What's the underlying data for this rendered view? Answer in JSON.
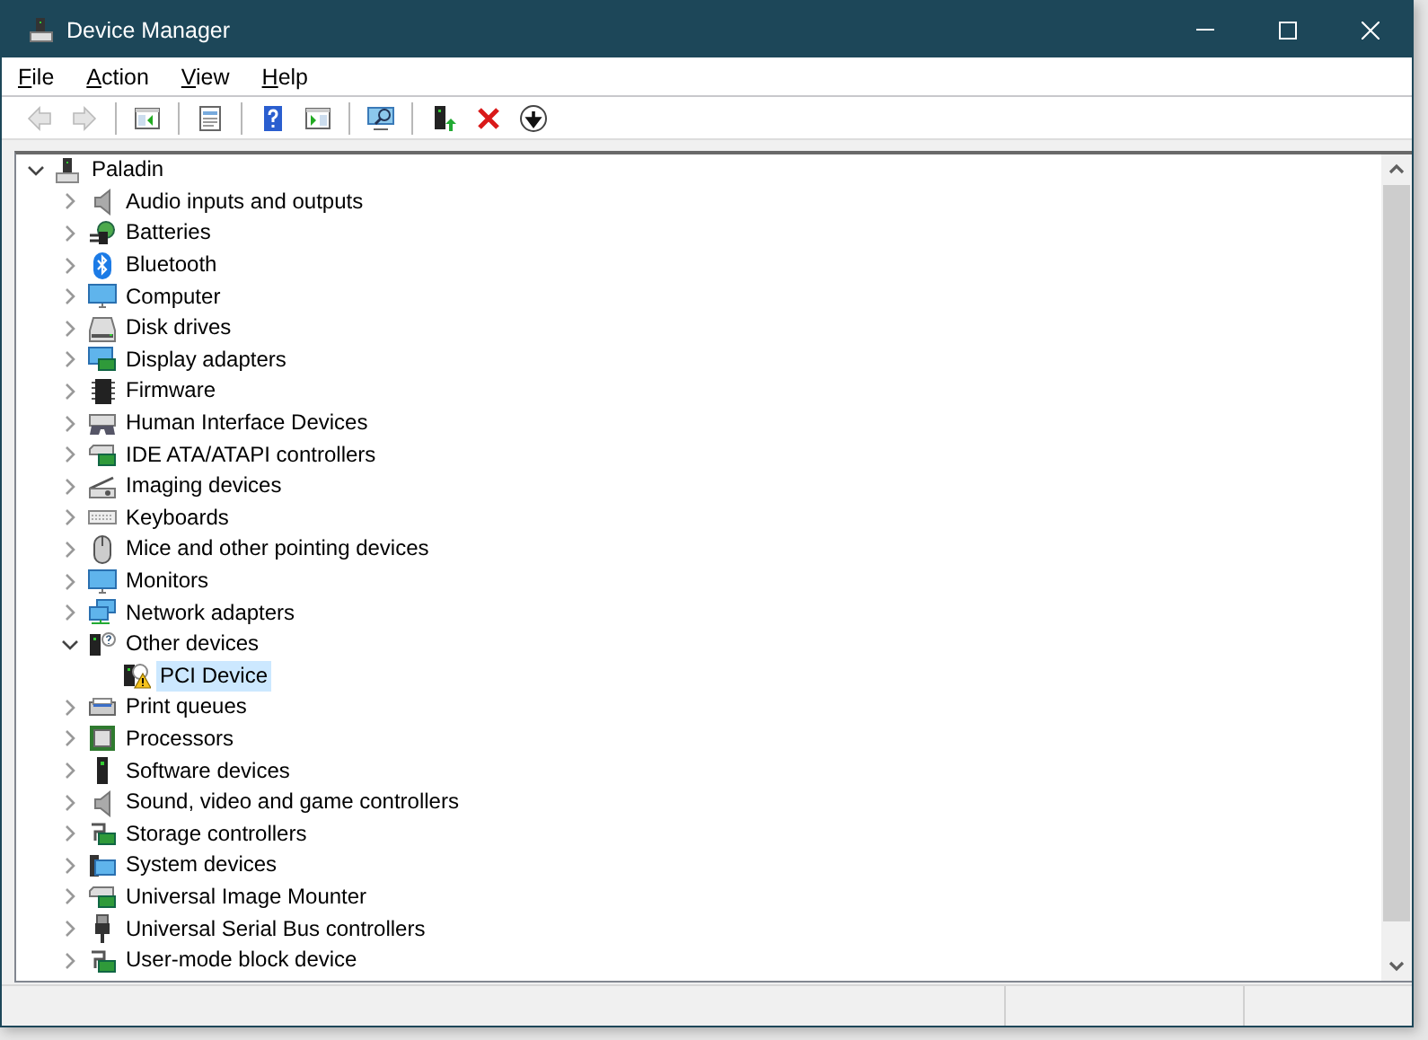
{
  "window": {
    "title": "Device Manager"
  },
  "menu": [
    {
      "label": "File"
    },
    {
      "label": "Action"
    },
    {
      "label": "View"
    },
    {
      "label": "Help"
    }
  ],
  "toolbar": [
    {
      "kind": "back",
      "disabled": true
    },
    {
      "kind": "forward",
      "disabled": true
    },
    {
      "kind": "sep"
    },
    {
      "kind": "show-hide-tree",
      "disabled": false
    },
    {
      "kind": "sep"
    },
    {
      "kind": "properties",
      "disabled": false
    },
    {
      "kind": "sep"
    },
    {
      "kind": "help",
      "disabled": false
    },
    {
      "kind": "show-hide-action",
      "disabled": false
    },
    {
      "kind": "sep"
    },
    {
      "kind": "scan",
      "disabled": false
    },
    {
      "kind": "sep"
    },
    {
      "kind": "update-driver",
      "disabled": false
    },
    {
      "kind": "uninstall",
      "disabled": false
    },
    {
      "kind": "disable",
      "disabled": false
    }
  ],
  "tree": [
    {
      "label": "Paladin",
      "kind": "computer-root",
      "expanded": true,
      "selected": false,
      "children": [
        {
          "label": "Audio inputs and outputs",
          "kind": "speaker",
          "expanded": false,
          "selected": false
        },
        {
          "label": "Batteries",
          "kind": "battery",
          "expanded": false,
          "selected": false
        },
        {
          "label": "Bluetooth",
          "kind": "bluetooth",
          "expanded": false,
          "selected": false
        },
        {
          "label": "Computer",
          "kind": "monitor",
          "expanded": false,
          "selected": false
        },
        {
          "label": "Disk drives",
          "kind": "disk",
          "expanded": false,
          "selected": false
        },
        {
          "label": "Display adapters",
          "kind": "display-card",
          "expanded": false,
          "selected": false
        },
        {
          "label": "Firmware",
          "kind": "chip",
          "expanded": false,
          "selected": false
        },
        {
          "label": "Human Interface Devices",
          "kind": "hid",
          "expanded": false,
          "selected": false
        },
        {
          "label": "IDE ATA/ATAPI controllers",
          "kind": "controller",
          "expanded": false,
          "selected": false
        },
        {
          "label": "Imaging devices",
          "kind": "camera",
          "expanded": false,
          "selected": false
        },
        {
          "label": "Keyboards",
          "kind": "keyboard",
          "expanded": false,
          "selected": false
        },
        {
          "label": "Mice and other pointing devices",
          "kind": "mouse",
          "expanded": false,
          "selected": false
        },
        {
          "label": "Monitors",
          "kind": "monitor",
          "expanded": false,
          "selected": false
        },
        {
          "label": "Network adapters",
          "kind": "network",
          "expanded": false,
          "selected": false
        },
        {
          "label": "Other devices",
          "kind": "unknown",
          "expanded": true,
          "selected": false,
          "children": [
            {
              "label": "PCI Device",
              "kind": "warning-device",
              "selected": true
            }
          ]
        },
        {
          "label": "Print queues",
          "kind": "printer",
          "expanded": false,
          "selected": false
        },
        {
          "label": "Processors",
          "kind": "processor",
          "expanded": false,
          "selected": false
        },
        {
          "label": "Software devices",
          "kind": "tower",
          "expanded": false,
          "selected": false
        },
        {
          "label": "Sound, video and game controllers",
          "kind": "speaker",
          "expanded": false,
          "selected": false
        },
        {
          "label": "Storage controllers",
          "kind": "storage",
          "expanded": false,
          "selected": false
        },
        {
          "label": "System devices",
          "kind": "system",
          "expanded": false,
          "selected": false
        },
        {
          "label": "Universal Image Mounter",
          "kind": "controller",
          "expanded": false,
          "selected": false
        },
        {
          "label": "Universal Serial Bus controllers",
          "kind": "usb",
          "expanded": false,
          "selected": false
        },
        {
          "label": "User-mode block device",
          "kind": "storage",
          "expanded": false,
          "selected": false
        }
      ]
    }
  ]
}
